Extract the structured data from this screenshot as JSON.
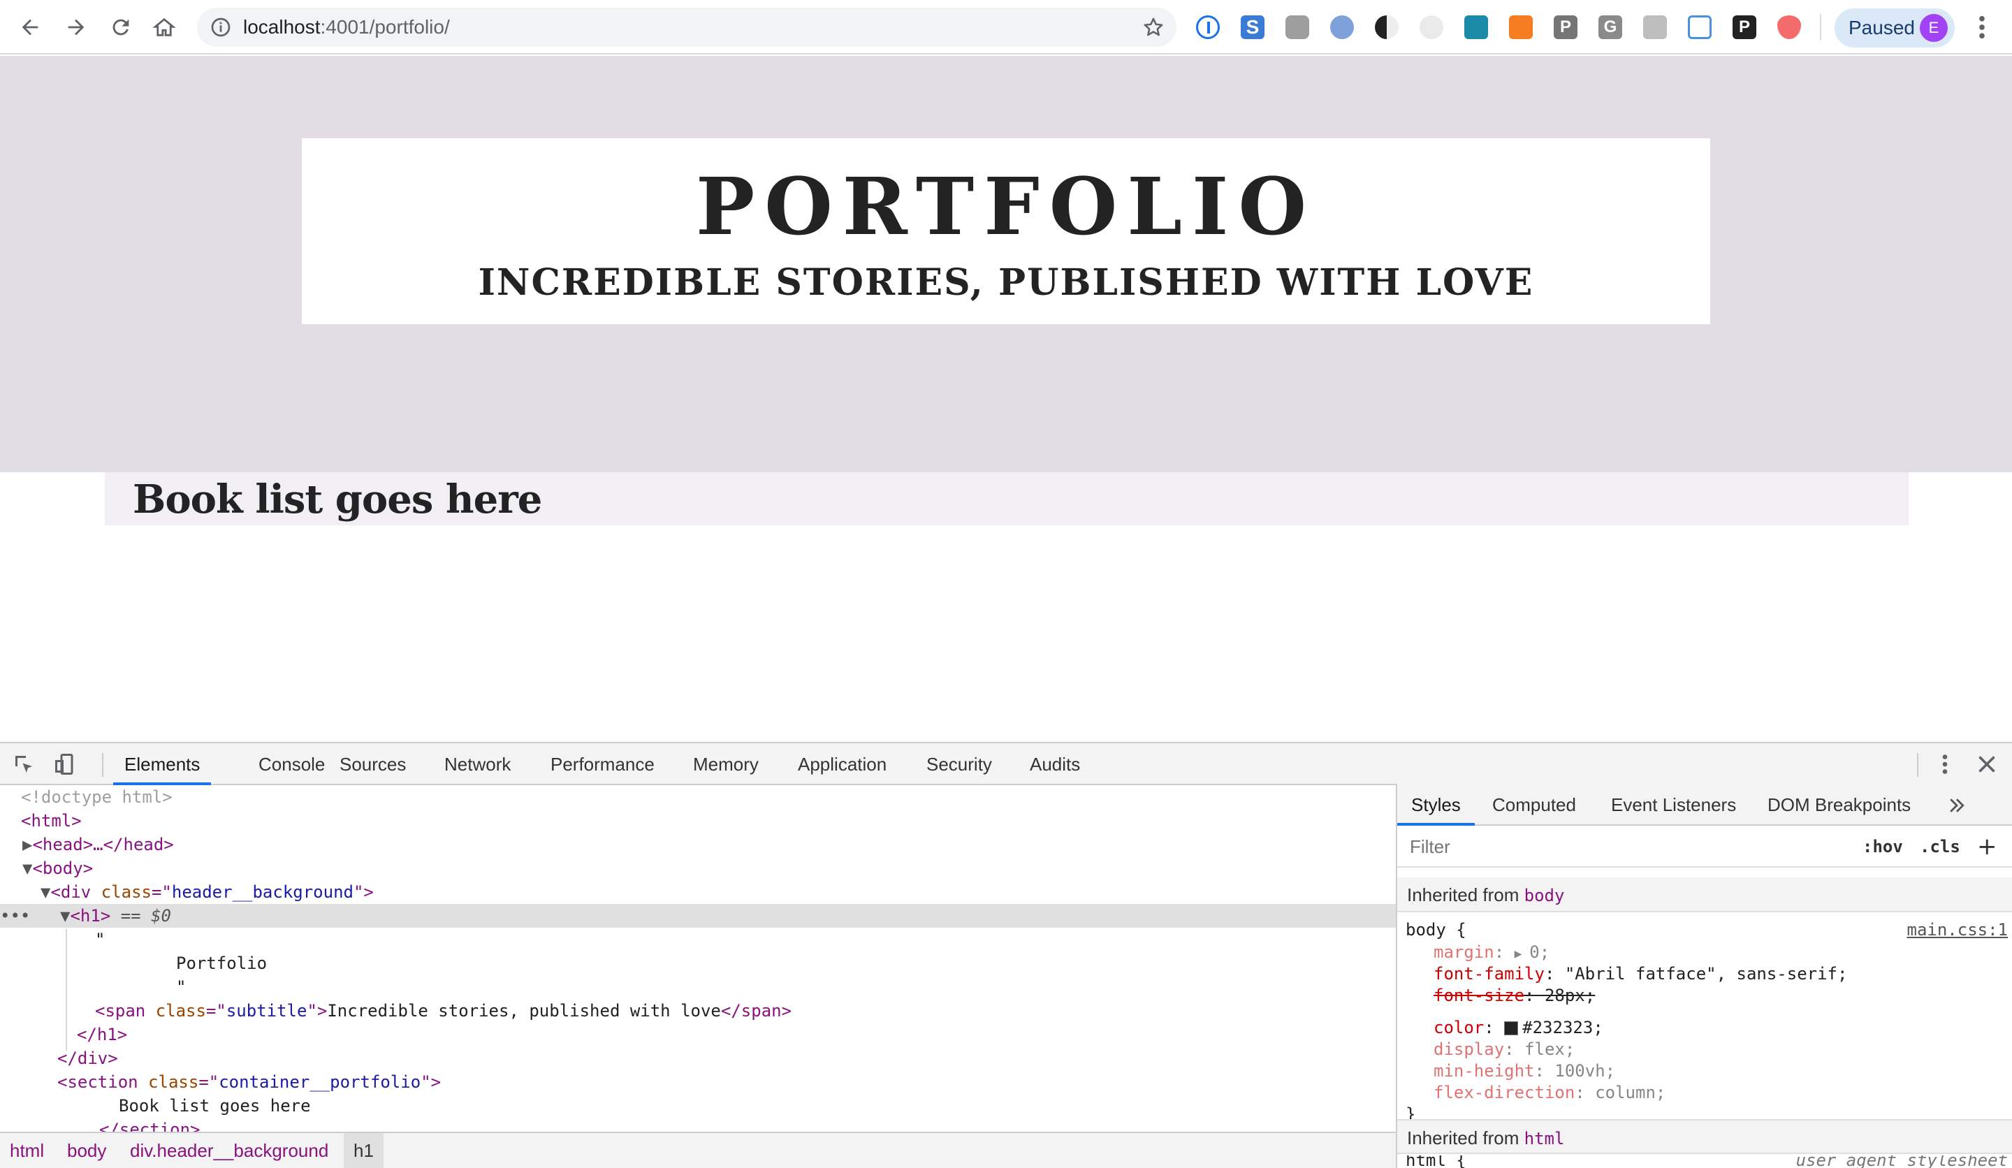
{
  "browser": {
    "url_host": "localhost",
    "url_rest": ":4001/portfolio/",
    "profile_label": "Paused",
    "profile_initial": "E",
    "extension_icons": [
      "onepassword-icon",
      "s-extension-icon",
      "puzzle-extension-icon",
      "paint-extension-icon",
      "dark-mode-icon",
      "react-devtools-icon",
      "camera-extension-icon",
      "lock-extension-icon",
      "p-extension-icon",
      "g-extension-icon",
      "tab-extension-icon",
      "code-extension-icon",
      "p-dark-extension-icon",
      "shield-extension-icon"
    ]
  },
  "page": {
    "title": "PORTFOLIO",
    "subtitle": "INCREDIBLE STORIES, PUBLISHED WITH LOVE",
    "book_list": "Book list goes here"
  },
  "devtools": {
    "tabs": [
      "Elements",
      "Console",
      "Sources",
      "Network",
      "Performance",
      "Memory",
      "Application",
      "Security",
      "Audits"
    ],
    "active_tab": "Elements",
    "dom": {
      "doctype": "<!doctype html>",
      "html_open": "<html>",
      "head_collapsed": "<head>…</head>",
      "body_open": "<body>",
      "div_tag": "div",
      "div_attr": "class",
      "div_val": "header__background",
      "h1_tag": "h1",
      "h1_marker": " == $0",
      "quote_open": "\"",
      "portfolio_text": "Portfolio",
      "quote_close": "\"",
      "span_tag": "span",
      "span_attr": "class",
      "span_val": "subtitle",
      "span_text": "Incredible stories, published with love",
      "h1_close": "</h1>",
      "div_close": "</div>",
      "section_tag": "section",
      "section_attr": "class",
      "section_val": "container__portfolio",
      "section_text": "Book list goes here",
      "section_close": "</section>"
    },
    "breadcrumbs": [
      "html",
      "body",
      "div.header__background",
      "h1"
    ],
    "styles": {
      "tabs": [
        "Styles",
        "Computed",
        "Event Listeners",
        "DOM Breakpoints"
      ],
      "active_tab": "Styles",
      "filter_placeholder": "Filter",
      "hov_label": ":hov",
      "cls_label": ".cls",
      "plus_label": "+",
      "inherited_label": "Inherited from",
      "inherited_body": "body",
      "inherited_html": "html",
      "rule_selector": "body",
      "rule_source": "main.css:1",
      "declarations": [
        {
          "prop": "margin",
          "value": "0",
          "state": "inherited"
        },
        {
          "prop": "font-family",
          "value": "\"Abril fatface\", sans-serif",
          "state": "active"
        },
        {
          "prop": "font-size",
          "value": "28px",
          "state": "struck"
        },
        {
          "prop": "color",
          "value": "#232323",
          "state": "active"
        },
        {
          "prop": "display",
          "value": "flex",
          "state": "inherited"
        },
        {
          "prop": "min-height",
          "value": "100vh",
          "state": "inherited"
        },
        {
          "prop": "flex-direction",
          "value": "column",
          "state": "inherited"
        }
      ],
      "next_selector": "html",
      "next_source": "user agent stylesheet"
    }
  },
  "colors": {
    "header_background": "#e2dde4",
    "text": "#232323",
    "accent": "#1a73e8",
    "section_background": "#f1eff3"
  }
}
